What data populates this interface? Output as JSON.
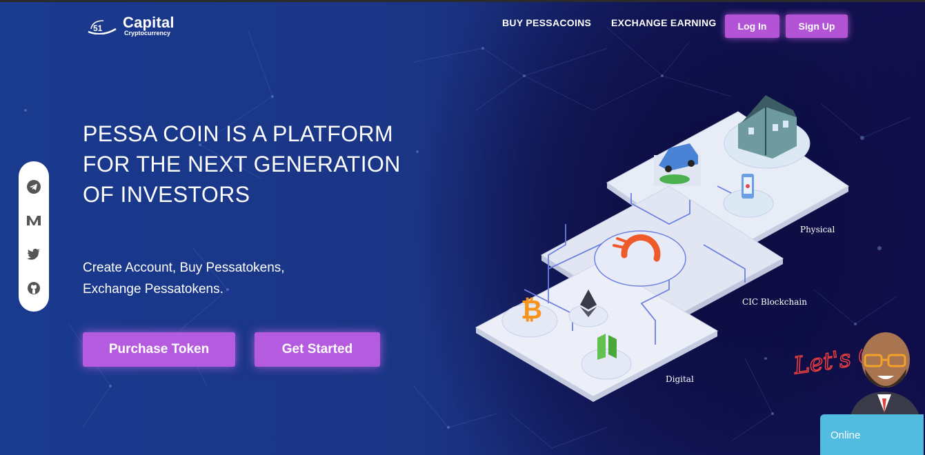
{
  "brand": {
    "badge": "51",
    "name": "Capital",
    "tagline": "Cryptocurrency"
  },
  "nav": {
    "links": [
      "BUY PESSACOINS",
      "EXCHANGE EARNING"
    ],
    "login": "Log In",
    "signup": "Sign Up"
  },
  "social": [
    "telegram-icon",
    "medium-icon",
    "twitter-icon",
    "github-icon"
  ],
  "hero": {
    "title_lines": [
      "PESSA COIN IS A PLATFORM",
      "FOR THE NEXT GENERATION",
      "OF INVESTORS"
    ],
    "subtitle_lines": [
      "Create Account, Buy Pessatokens,",
      "Exchange Pessatokens."
    ],
    "primary_cta": "Purchase Token",
    "secondary_cta": "Get Started"
  },
  "illustration": {
    "layers": [
      "Physical",
      "CIC Blockchain",
      "Digital"
    ],
    "icons": [
      "house-icon",
      "car-icon",
      "phone-icon",
      "cic-logo-icon",
      "bitcoin-icon",
      "ethereum-icon",
      "neo-icon"
    ]
  },
  "chat": {
    "callout": "Let's Chat",
    "status": "Online"
  },
  "colors": {
    "accent": "#b55be0",
    "chat": "#52bce0",
    "bg": "#1b3585"
  }
}
